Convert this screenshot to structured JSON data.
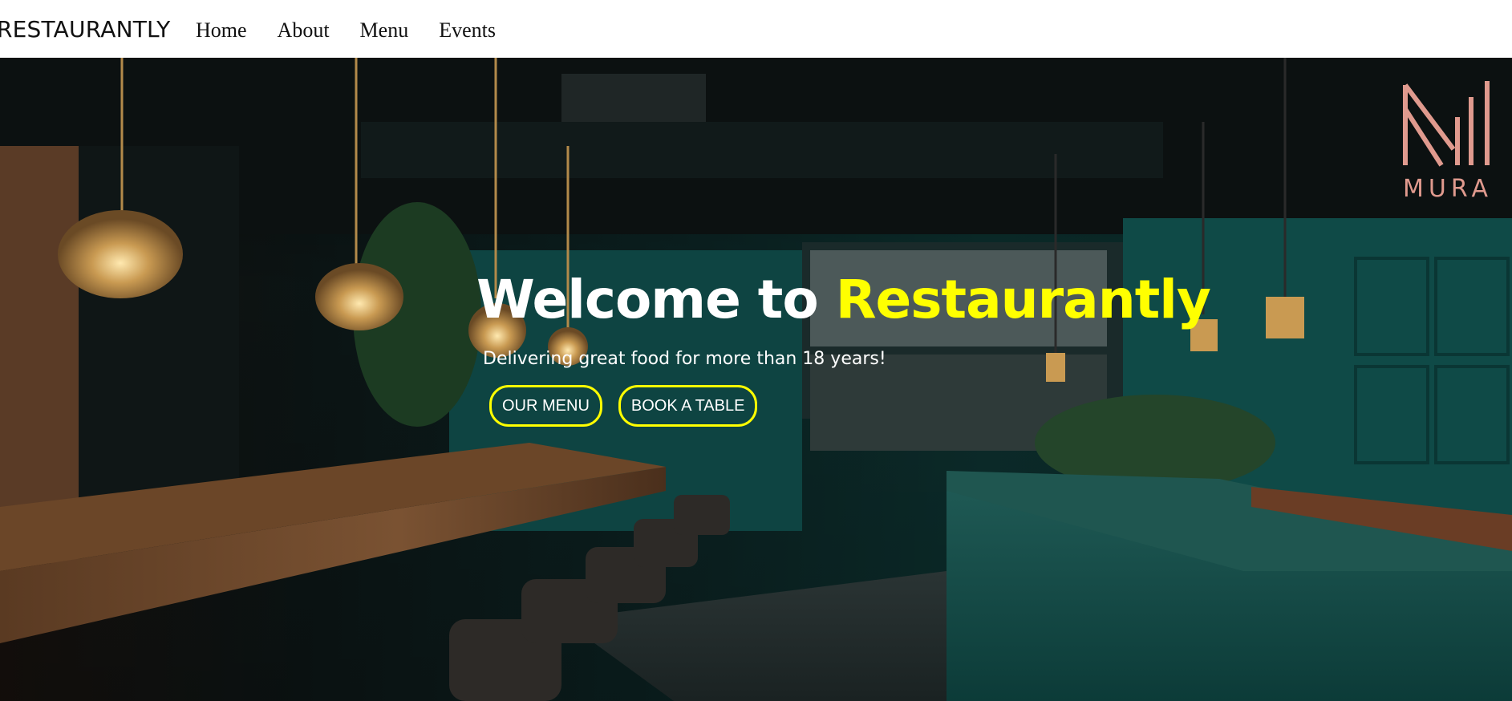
{
  "navbar": {
    "brand": "RESTAURANTLY",
    "links": [
      "Home",
      "About",
      "Menu",
      "Events"
    ]
  },
  "hero": {
    "title_prefix": "Welcome to ",
    "title_accent": "Restaurantly",
    "subtitle": "Delivering great food for more than 18 years!",
    "buttons": {
      "menu": "OUR MENU",
      "book": "BOOK A TABLE"
    },
    "logo_text": "MURA"
  },
  "colors": {
    "accent": "#ffff00",
    "hero_text": "#ffffff",
    "navbar_bg": "#ffffff",
    "wall_teal": "#0f3a38",
    "logo": "#e09a8e"
  },
  "icons": {
    "logo_mark": "mura-logo-icon"
  }
}
